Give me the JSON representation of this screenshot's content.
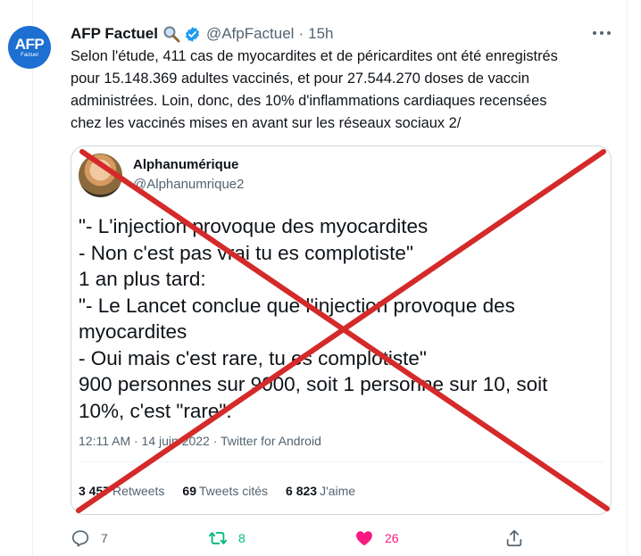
{
  "tweet": {
    "avatar": {
      "logo": "AFP",
      "sub": "Factuel"
    },
    "author_name": "AFP Factuel",
    "magnifier_icon": "magnifier-icon",
    "verified_icon": "verified-badge-icon",
    "handle": "@AfpFactuel",
    "separator": "·",
    "time": "15h",
    "more_icon": "more-icon",
    "text_lines": [
      "Selon l'étude, 411 cas de myocardites et de péricardites ont été enregistrés",
      "pour 15.148.369 adultes vaccinés, et pour 27.544.270 doses de vaccin",
      "administrées. Loin, donc, des 10% d'inflammations cardiaques recensées",
      "chez les vaccinés mises en avant  sur les réseaux sociaux 2/"
    ]
  },
  "quoted": {
    "name": "Alphanumérique",
    "handle": "@Alphanumrique2",
    "text_lines": [
      "\"- L'injection provoque des myocardites",
      "- Non c'est pas vrai tu es complotiste\"",
      "1 an plus tard:",
      "\"- Le Lancet conclue que l'injection provoque des",
      "myocardites",
      "- Oui mais c'est rare, tu es complotiste\"",
      "900 personnes sur 9000, soit 1 personne sur 10, soit",
      "10%, c'est \"rare\"."
    ],
    "meta": "12:11 AM · 14 juin 2022 · Twitter for Android",
    "stats": {
      "retweets_count": "3 457",
      "retweets_label": "Retweets",
      "quotes_count": "69",
      "quotes_label": "Tweets cités",
      "likes_count": "6 823",
      "likes_label": "J'aime"
    }
  },
  "actions": {
    "reply_count": "7",
    "retweet_count": "8",
    "like_count": "26"
  },
  "colors": {
    "cross": "#d42a2a",
    "retweet": "#00ba7c",
    "like": "#f91880",
    "verified": "#1d9bf0",
    "afp_blue": "#1d6fd1"
  }
}
